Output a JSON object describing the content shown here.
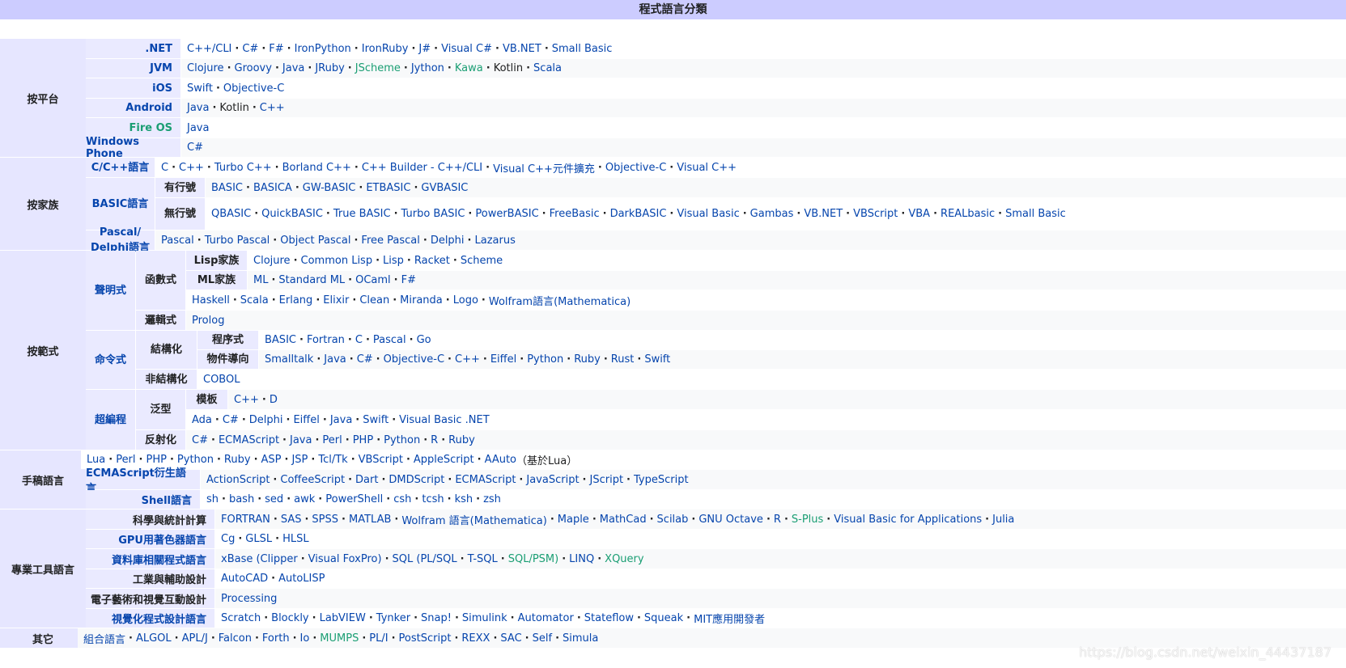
{
  "title": "程式語言分類",
  "groups": [
    {
      "label": "按平台",
      "rows": [
        {
          "h": [
            ".NET"
          ],
          "items": [
            "C++/CLI",
            "C#",
            "F#",
            "IronPython",
            "IronRuby",
            "J#",
            "Visual C#",
            "VB.NET",
            "Small Basic"
          ]
        },
        {
          "h": [
            "JVM"
          ],
          "items": [
            "Clojure",
            "Groovy",
            "Java",
            "JRuby",
            "JScheme",
            "Jython",
            "Kawa",
            "Kotlin",
            "Scala"
          ],
          "green": [
            4,
            6
          ],
          "dark": [
            7
          ]
        },
        {
          "h": [
            "iOS"
          ],
          "items": [
            "Swift",
            "Objective-C"
          ]
        },
        {
          "h": [
            "Android"
          ],
          "items": [
            "Java",
            "Kotlin",
            "C++"
          ],
          "dark": [
            1
          ]
        },
        {
          "h": [
            "Fire OS"
          ],
          "items": [
            "Java"
          ],
          "hGreen": true
        },
        {
          "h": [
            "Windows Phone"
          ],
          "items": [
            "C#"
          ]
        }
      ]
    },
    {
      "label": "按家族",
      "rows": [
        {
          "h": [
            "C/C++語言"
          ],
          "items": [
            "C",
            "C++",
            "Turbo C++",
            "Borland C++",
            "C++ Builder - C++/CLI",
            "Visual C++元件擴充",
            "Objective-C",
            "Visual C++"
          ]
        },
        {
          "h": [
            "BASIC語言",
            "有行號"
          ],
          "items": [
            "BASIC",
            "BASICA",
            "GW-BASIC",
            "ETBASIC",
            "GVBASIC"
          ]
        },
        {
          "h": [
            "BASIC語言",
            "無行號"
          ],
          "items": [
            "QBASIC",
            "QuickBASIC",
            "True BASIC",
            "Turbo BASIC",
            "PowerBASIC",
            "FreeBasic",
            "DarkBASIC",
            "Visual Basic",
            "Gambas",
            "VB.NET",
            "VBScript",
            "VBA",
            "REALbasic",
            "Small Basic"
          ]
        },
        {
          "h": [
            "Pascal/ Delphi語言"
          ],
          "items": [
            "Pascal",
            "Turbo Pascal",
            "Object Pascal",
            "Free Pascal",
            "Delphi",
            "Lazarus"
          ]
        }
      ]
    },
    {
      "label": "按範式",
      "rows": [
        {
          "h": [
            "聲明式",
            "函數式",
            "Lisp家族"
          ],
          "items": [
            "Clojure",
            "Common Lisp",
            "Lisp",
            "Racket",
            "Scheme"
          ]
        },
        {
          "h": [
            "聲明式",
            "函數式",
            "ML家族"
          ],
          "items": [
            "ML",
            "Standard ML",
            "OCaml",
            "F#"
          ]
        },
        {
          "h": [
            "聲明式",
            "函數式"
          ],
          "items": [
            "Haskell",
            "Scala",
            "Erlang",
            "Elixir",
            "Clean",
            "Miranda",
            "Logo",
            "Wolfram語言(Mathematica)"
          ]
        },
        {
          "h": [
            "聲明式",
            "邏輯式"
          ],
          "items": [
            "Prolog"
          ]
        },
        {
          "h": [
            "命令式",
            "結構化",
            "程序式"
          ],
          "items": [
            "BASIC",
            "Fortran",
            "C",
            "Pascal",
            "Go"
          ]
        },
        {
          "h": [
            "命令式",
            "結構化",
            "物件導向"
          ],
          "items": [
            "Smalltalk",
            "Java",
            "C#",
            "Objective-C",
            "C++",
            "Eiffel",
            "Python",
            "Ruby",
            "Rust",
            "Swift"
          ]
        },
        {
          "h": [
            "命令式",
            "非結構化"
          ],
          "items": [
            "COBOL"
          ]
        },
        {
          "h": [
            "超編程",
            "泛型",
            "模板"
          ],
          "items": [
            "C++",
            "D"
          ]
        },
        {
          "h": [
            "超編程",
            "泛型"
          ],
          "items": [
            "Ada",
            "C#",
            "Delphi",
            "Eiffel",
            "Java",
            "Swift",
            "Visual Basic .NET"
          ]
        },
        {
          "h": [
            "超編程",
            "反射化"
          ],
          "items": [
            "C#",
            "ECMAScript",
            "Java",
            "Perl",
            "PHP",
            "Python",
            "R",
            "Ruby"
          ]
        }
      ]
    },
    {
      "label": "手稿語言",
      "rows": [
        {
          "h": [],
          "items": [
            "Lua",
            "Perl",
            "PHP",
            "Python",
            "Ruby",
            "ASP",
            "JSP",
            "Tcl/Tk",
            "VBScript",
            "AppleScript",
            "AAuto"
          ],
          "suffix": "（基於Lua）"
        },
        {
          "h": [
            "ECMAScript衍生語言"
          ],
          "items": [
            "ActionScript",
            "CoffeeScript",
            "Dart",
            "DMDScript",
            "ECMAScript",
            "JavaScript",
            "JScript",
            "TypeScript"
          ]
        },
        {
          "h": [
            "Shell語言"
          ],
          "items": [
            "sh",
            "bash",
            "sed",
            "awk",
            "PowerShell",
            "csh",
            "tcsh",
            "ksh",
            "zsh"
          ]
        }
      ]
    },
    {
      "label": "專業工具語言",
      "rows": [
        {
          "h": [
            "科學與統計計算"
          ],
          "items": [
            "FORTRAN",
            "SAS",
            "SPSS",
            "MATLAB",
            "Wolfram 語言(Mathematica)",
            "Maple",
            "MathCad",
            "Scilab",
            "GNU Octave",
            "R",
            "S-Plus",
            "Visual Basic for Applications",
            "Julia"
          ],
          "green": [
            10
          ],
          "hDark": true
        },
        {
          "h": [
            "GPU用著色器語言"
          ],
          "items": [
            "Cg",
            "GLSL",
            "HLSL"
          ]
        },
        {
          "h": [
            "資料庫相關程式語言"
          ],
          "items": [
            "xBase (Clipper",
            "Visual FoxPro)",
            "SQL (PL/SQL",
            "T-SQL",
            "SQL/PSM)",
            "LINQ",
            "XQuery"
          ],
          "green": [
            4,
            6
          ]
        },
        {
          "h": [
            "工業與輔助設計"
          ],
          "items": [
            "AutoCAD",
            "AutoLISP"
          ],
          "hDark": true
        },
        {
          "h": [
            "電子藝術和視覺互動設計"
          ],
          "items": [
            "Processing"
          ],
          "hDark": true
        },
        {
          "h": [
            "視覺化程式設計語言"
          ],
          "items": [
            "Scratch",
            "Blockly",
            "LabVIEW",
            "Tynker",
            "Snap!",
            "Simulink",
            "Automator",
            "Stateflow",
            "Squeak",
            "MIT應用開發者"
          ]
        }
      ]
    },
    {
      "label": "其它",
      "rows": [
        {
          "h": [],
          "items": [
            "組合語言",
            "ALGOL",
            "APL/J",
            "Falcon",
            "Forth",
            "Io",
            "MUMPS",
            "PL/I",
            "PostScript",
            "REXX",
            "SAC",
            "Self",
            "Simula"
          ],
          "green": [
            6
          ]
        }
      ]
    }
  ],
  "watermark": "https://blog.csdn.net/weixin_44437187"
}
